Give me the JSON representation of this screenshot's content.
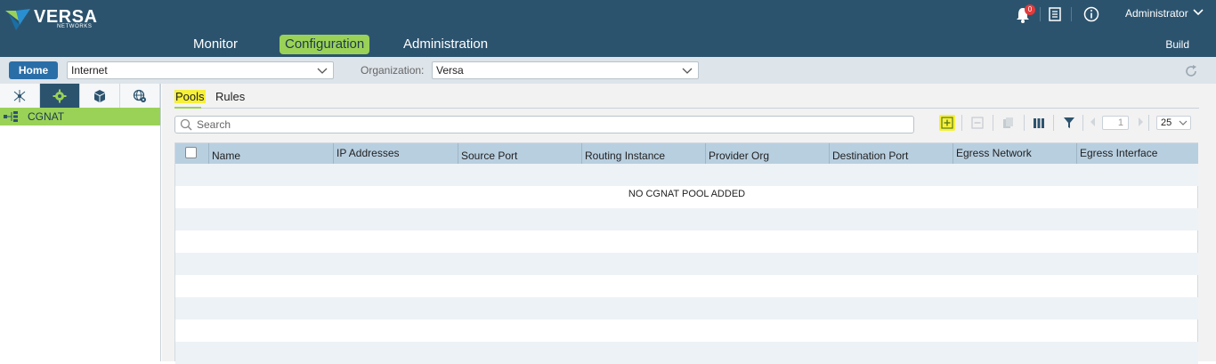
{
  "header": {
    "brand": "VERSA",
    "brand_sub": "NETWORKS",
    "nav": [
      {
        "label": "Monitor",
        "active": false
      },
      {
        "label": "Configuration",
        "active": true
      },
      {
        "label": "Administration",
        "active": false
      }
    ],
    "build_label": "Build",
    "notification_count": "0",
    "user": "Administrator"
  },
  "subbar": {
    "home_label": "Home",
    "context_select": "Internet",
    "org_label": "Organization:",
    "org_select": "Versa"
  },
  "left_panel": {
    "tabs": [
      "network-icon",
      "gear-icon",
      "cube-icon",
      "globe-gear-icon"
    ],
    "tree": [
      {
        "label": "CGNAT",
        "selected": true
      }
    ]
  },
  "main": {
    "tabs": [
      {
        "label": "Pools",
        "active": true
      },
      {
        "label": "Rules",
        "active": false
      }
    ],
    "search_placeholder": "Search",
    "pager_page": "1",
    "page_size": "25",
    "columns": [
      "Name",
      "IP Addresses",
      "Source Port",
      "Routing Instance",
      "Provider Org",
      "Destination Port",
      "Egress Network",
      "Egress Interface"
    ],
    "empty_message": "NO CGNAT POOL ADDED"
  },
  "colors": {
    "header_bg": "#2c536e",
    "accent_green": "#9ad257",
    "highlight_yellow": "#f6f03a",
    "grid_header": "#b8cfe0"
  }
}
